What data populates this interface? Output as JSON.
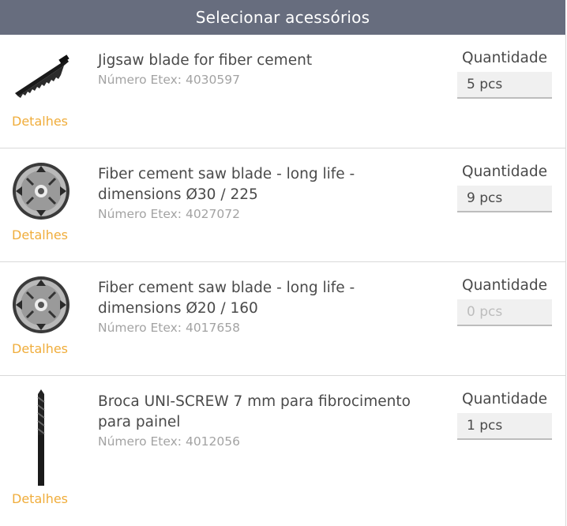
{
  "header": {
    "title": "Selecionar acessórios"
  },
  "items": [
    {
      "title": "Jigsaw blade for fiber cement",
      "number": "Número Etex: 4030597",
      "details_label": "Detalhes",
      "quantity_label": "Quantidade",
      "quantity_value": "5 pcs",
      "quantity_placeholder": "",
      "icon": "jigsaw-blade-icon"
    },
    {
      "title": "Fiber cement saw blade - long life - dimensions Ø30 / 225",
      "number": "Número Etex: 4027072",
      "details_label": "Detalhes",
      "quantity_label": "Quantidade",
      "quantity_value": "9 pcs",
      "quantity_placeholder": "",
      "icon": "saw-blade-icon"
    },
    {
      "title": "Fiber cement saw blade - long life - dimensions Ø20 / 160",
      "number": "Número Etex: 4017658",
      "details_label": "Detalhes",
      "quantity_label": "Quantidade",
      "quantity_value": "",
      "quantity_placeholder": "0 pcs",
      "icon": "saw-blade-icon"
    },
    {
      "title": "Broca UNI-SCREW 7 mm para fibrocimento para painel",
      "number": "Número Etex: 4012056",
      "details_label": "Detalhes",
      "quantity_label": "Quantidade",
      "quantity_value": "1 pcs",
      "quantity_placeholder": "",
      "icon": "drill-bit-icon"
    }
  ],
  "colors": {
    "header_bg": "#676d7e",
    "details_link": "#f0ad3b",
    "input_bg": "#f0f0f0"
  }
}
